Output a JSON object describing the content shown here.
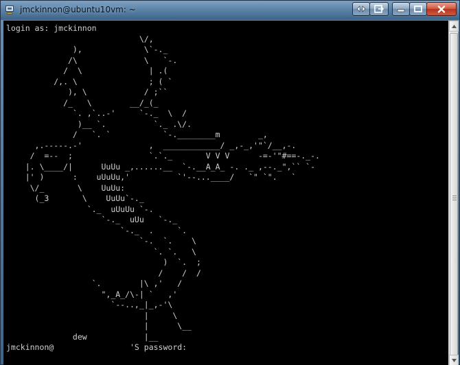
{
  "window": {
    "title": "jmckinnon@ubuntu10vm: ~",
    "controls": {
      "extra_icon": "transfer-arrows-icon",
      "pin_icon": "pin-window-icon",
      "minimize_icon": "minimize-icon",
      "maximize_icon": "maximize-icon",
      "close_icon": "close-icon"
    }
  },
  "terminal": {
    "lines": [
      "login as: jmckinnon",
      "                            \\/,",
      "              ),             \\`-._",
      "             /\\              \\   `-.",
      "            /  \\              | .(",
      "          /,. \\               ; ( `",
      "             ), \\            / ;``",
      "            /_   \\        __/_(_",
      "              `. ,`..-'     `-._  \\  /",
      "               )__ `.          `._ .\\/.",
      "              /   `. `           `-.________m        _,",
      "      ,.-----.-'              ,  ____________/ _,-_,'\"`/__,-.",
      "     /  =--  ;                `.`._       V V V      -=-'\"#==-._-.",
      "    |. \\____/|      UuUu _,......__  `-.__A_A_ -. ._ ,--._\",`` `-",
      "    |' )      :    uUuUu,'          `'--...____/   `\" `\".   `",
      "     \\/_       \\    UuUu:",
      "      (_3       \\    UuUu`-._",
      "                 `._  uUuUu `-.",
      "                    `-._  uUu   `-._",
      "                        `-._  .     `.",
      "                            `-.  `.    \\",
      "                               `. `.   \\",
      "                                 )  `.  ;",
      "                                /    /  /",
      "                  `.        |\\ ,'   /",
      "                    \",_A_/\\-| `   ,'",
      "                      `--..,_|_,-'\\",
      "                             |     \\",
      "                             |      \\__",
      "              dew            |__",
      "jmckinnon@                'S password: "
    ]
  },
  "scrollbar": {
    "up_icon": "scroll-up-arrow-icon",
    "down_icon": "scroll-down-arrow-icon"
  },
  "colors": {
    "terminal_bg": "#000000",
    "terminal_fg": "#d0d0d0",
    "titlebar": "#5c83a8",
    "close_button": "#c7432a"
  }
}
